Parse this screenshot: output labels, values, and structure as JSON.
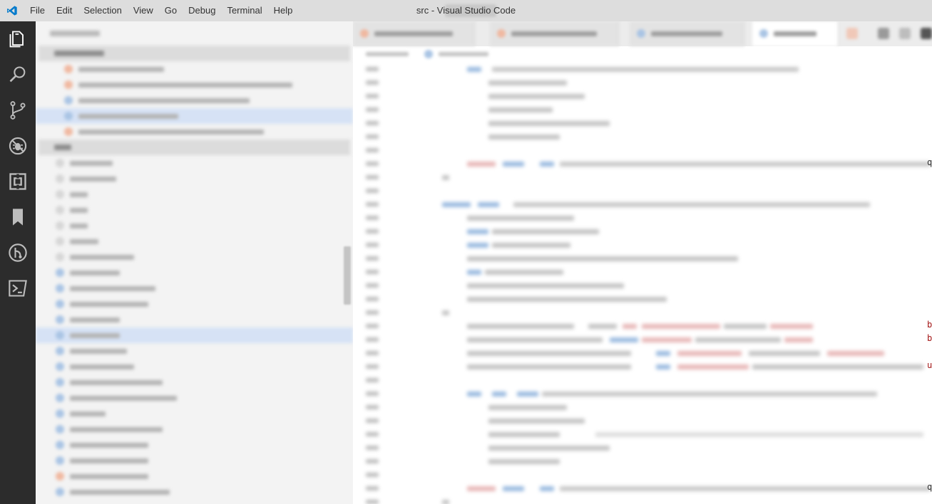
{
  "window": {
    "title": "src - Visual Studio Code"
  },
  "menu": {
    "items": [
      "File",
      "Edit",
      "Selection",
      "View",
      "Go",
      "Debug",
      "Terminal",
      "Help"
    ]
  },
  "activity_bar": {
    "icons": [
      "explorer-icon",
      "search-icon",
      "source-control-icon",
      "debug-icon",
      "extensions-icon",
      "bookmarks-icon",
      "git-graph-icon",
      "terminal-icon"
    ]
  },
  "editor": {
    "edge_chars": [
      {
        "line": 8,
        "char": "q"
      },
      {
        "line": 20,
        "char": "b"
      },
      {
        "line": 21,
        "char": "b"
      },
      {
        "line": 23,
        "char": "u"
      },
      {
        "line": 32,
        "char": "q"
      }
    ]
  },
  "colors": {
    "activity_bar": "#2c2c2c",
    "title_bar": "#dddddd",
    "sidebar": "#f3f3f3",
    "accent": "#007acc"
  }
}
